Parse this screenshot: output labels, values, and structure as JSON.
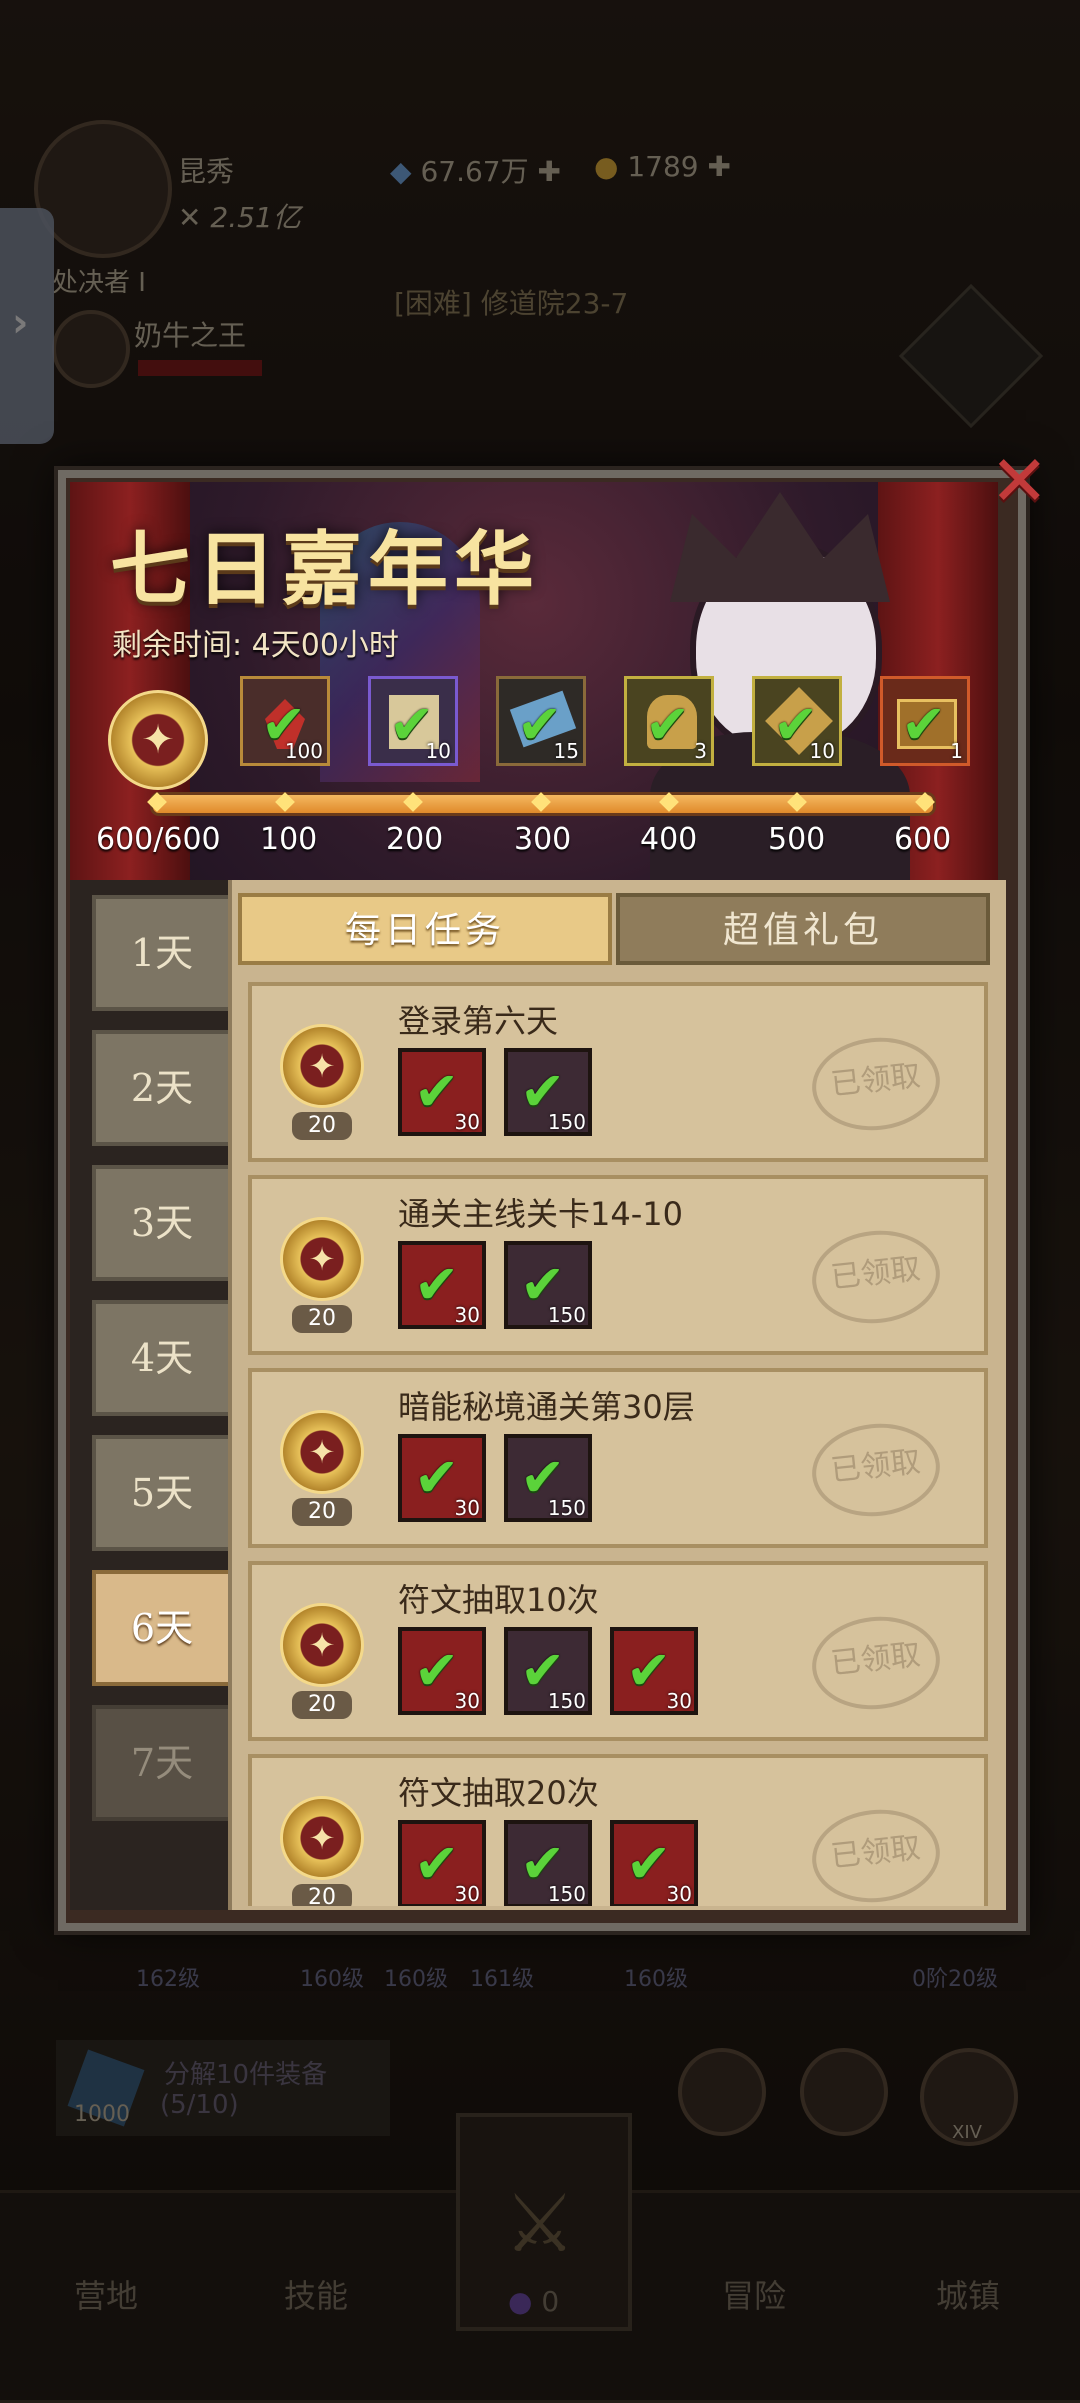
{
  "hud": {
    "player_name": "昆秀",
    "power": "2.51亿",
    "crystal": "67.67万",
    "coin": "1789",
    "rank_title": "处决者 I",
    "pet_name": "奶牛之王",
    "stage_text": "[困难] 修道院23-7"
  },
  "event": {
    "title": "七日嘉年华",
    "remaining_label": "剩余时间:",
    "remaining_value": "4天00小时",
    "progress": "600/600",
    "progress_fraction": 1.0,
    "milestones": [
      "100",
      "200",
      "300",
      "400",
      "500",
      "600"
    ],
    "milestone_rewards": [
      {
        "icon": "red-gem-icon",
        "count": "100",
        "claimed": true
      },
      {
        "icon": "scroll-icon",
        "count": "10",
        "claimed": true
      },
      {
        "icon": "blue-crystal-icon",
        "count": "15",
        "claimed": true
      },
      {
        "icon": "golden-helmet-icon",
        "count": "3",
        "claimed": true
      },
      {
        "icon": "hammer-icon",
        "count": "10",
        "claimed": true
      },
      {
        "icon": "treasure-chest-icon",
        "count": "1",
        "claimed": true
      }
    ]
  },
  "days": [
    "1天",
    "2天",
    "3天",
    "4天",
    "5天",
    "6天",
    "7天"
  ],
  "active_day": "6天",
  "tabs": {
    "daily": "每日任务",
    "gift": "超值礼包"
  },
  "tasks": [
    {
      "title": "登录第六天",
      "points": "20",
      "items": [
        {
          "type": "red",
          "icon": "gold-stone-icon",
          "count": "30"
        },
        {
          "type": "purple",
          "icon": "purple-crystal-icon",
          "count": "150"
        }
      ],
      "status": "已领取"
    },
    {
      "title": "通关主线关卡14-10",
      "points": "20",
      "items": [
        {
          "type": "red",
          "icon": "gold-stone-icon",
          "count": "30"
        },
        {
          "type": "purple",
          "icon": "purple-crystal-icon",
          "count": "150"
        }
      ],
      "status": "已领取"
    },
    {
      "title": "暗能秘境通关第30层",
      "points": "20",
      "items": [
        {
          "type": "red",
          "icon": "gold-stone-icon",
          "count": "30"
        },
        {
          "type": "purple",
          "icon": "purple-crystal-icon",
          "count": "150"
        }
      ],
      "status": "已领取"
    },
    {
      "title": "符文抽取10次",
      "points": "20",
      "items": [
        {
          "type": "red",
          "icon": "gold-stone-icon",
          "count": "30"
        },
        {
          "type": "purple",
          "icon": "purple-crystal-icon",
          "count": "150"
        },
        {
          "type": "red",
          "icon": "red-gem-icon",
          "count": "30"
        }
      ],
      "status": "已领取"
    },
    {
      "title": "符文抽取20次",
      "points": "20",
      "items": [
        {
          "type": "red",
          "icon": "gold-stone-icon",
          "count": "30"
        },
        {
          "type": "purple",
          "icon": "purple-crystal-icon",
          "count": "150"
        },
        {
          "type": "red",
          "icon": "red-gem-icon",
          "count": "30"
        }
      ],
      "status": "已领取"
    }
  ],
  "under": {
    "equip_levels": [
      "162级",
      "160级",
      "160级",
      "161级",
      "160级",
      "0阶20级"
    ],
    "salvage_text": "分解10件装备",
    "salvage_progress": "(5/10)",
    "salvage_reward": "1000",
    "tier_badge": "XIV"
  },
  "nav": {
    "camp": "营地",
    "skill": "技能",
    "battle_count": "0",
    "adventure": "冒险",
    "town": "城镇"
  },
  "colors": {
    "accent_gold": "#e8c987",
    "check_green": "#5bd33a",
    "close_red": "#c23a3a"
  }
}
